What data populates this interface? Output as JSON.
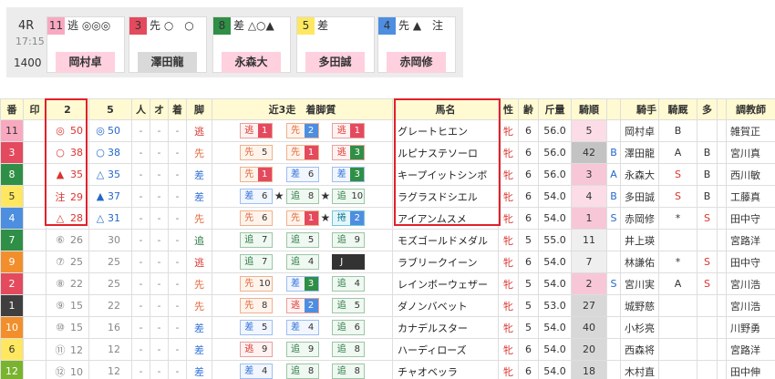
{
  "race": {
    "number": "4R",
    "time": "17:15",
    "distance": "1400"
  },
  "top_picks": [
    {
      "num": "11",
      "frame": 7,
      "marks": "逃 ◎◎◎",
      "jockey": "岡村卓",
      "jock_style": "pink"
    },
    {
      "num": "3",
      "frame": 2,
      "marks": "先 ○　○",
      "jockey": "澤田龍",
      "jock_style": "gray"
    },
    {
      "num": "8",
      "frame": 5,
      "marks": "差 △○▲",
      "jockey": "永森大",
      "jock_style": "pink"
    },
    {
      "num": "5",
      "frame": 4,
      "marks": "差",
      "jockey": "多田誠",
      "jock_style": "pink"
    },
    {
      "num": "4",
      "frame": 3,
      "marks": "先 ▲　注",
      "jockey": "赤岡修",
      "jock_style": "pink"
    }
  ],
  "headers": {
    "ban": "番",
    "in": "印",
    "c2": "2",
    "c5": "5",
    "hito": "人",
    "o": "オ",
    "chaku": "着",
    "ashi": "脚",
    "past": "近3走　着脚質",
    "name": "馬名",
    "sex": "性",
    "age": "齢",
    "weight": "斤量",
    "odds_rank": "騎順",
    "jockey": "騎手",
    "jk": "騎厩",
    "ta": "多",
    "trainer": "調教師"
  },
  "rows": [
    {
      "ban": "11",
      "frame": 7,
      "m2": "◎",
      "v2": "50",
      "m5": "◎",
      "v5": "50",
      "hito": "-",
      "o": "-",
      "chaku": "-",
      "ashi": "逃",
      "ashi_cls": "nige",
      "p": [
        {
          "st": "逃",
          "po": "1",
          "cls": "nige",
          "pw": 1
        },
        {
          "st": "先",
          "po": "2",
          "cls": "sen",
          "pw": 2
        },
        {
          "st": "逃",
          "po": "1",
          "cls": "nige",
          "pw": 1
        }
      ],
      "name": "グレートヒエン",
      "sex": "牝",
      "age": "6",
      "weight": "56.0",
      "rank": "5",
      "rank_cls": "lpk",
      "mark": "",
      "jockey": "岡村卓",
      "jk": "B",
      "ta": "",
      "trainer": "雑賀正"
    },
    {
      "ban": "3",
      "frame": 2,
      "m2": "○",
      "v2": "38",
      "m5": "○",
      "v5": "38",
      "hito": "-",
      "o": "-",
      "chaku": "-",
      "ashi": "先",
      "ashi_cls": "sen",
      "p": [
        {
          "st": "先",
          "po": "5",
          "cls": "sen",
          "pw": 0,
          "out": true
        },
        {
          "st": "先",
          "po": "1",
          "cls": "sen",
          "pw": 1
        },
        {
          "st": "逃",
          "po": "3",
          "cls": "nige",
          "pw": 3
        }
      ],
      "name": "ルピナステソーロ",
      "sex": "牝",
      "age": "6",
      "weight": "56.0",
      "rank": "42",
      "rank_cls": "dg",
      "mark": "B",
      "jockey": "澤田龍",
      "jk": "A",
      "ta": "B",
      "trainer": "宮川真"
    },
    {
      "ban": "8",
      "frame": 5,
      "m2": "▲",
      "v2": "35",
      "m5": "△",
      "v5": "35",
      "hito": "-",
      "o": "-",
      "chaku": "-",
      "ashi": "差",
      "ashi_cls": "sa",
      "p": [
        {
          "st": "先",
          "po": "1",
          "cls": "sen",
          "pw": 1
        },
        {
          "st": "差",
          "po": "6",
          "cls": "sa",
          "pw": 0,
          "out": true
        },
        {
          "st": "差",
          "po": "3",
          "cls": "sa",
          "pw": 3
        }
      ],
      "name": "キープイットシンボ",
      "sex": "牝",
      "age": "6",
      "weight": "56.0",
      "rank": "3",
      "rank_cls": "pk",
      "mark": "A",
      "jockey": "永森大",
      "jk": "S",
      "ta": "B",
      "trainer": "西川敏"
    },
    {
      "ban": "5",
      "frame": 4,
      "m2": "注",
      "v2": "29",
      "m5": "▲",
      "v5": "37",
      "hito": "-",
      "o": "-",
      "chaku": "-",
      "ashi": "差",
      "ashi_cls": "sa",
      "p": [
        {
          "st": "差",
          "po": "6",
          "cls": "sa",
          "pw": 0,
          "out": true,
          "star": true
        },
        {
          "st": "追",
          "po": "8",
          "cls": "oi",
          "pw": 0,
          "out": true,
          "star": true
        },
        {
          "st": "追",
          "po": "10",
          "cls": "oi",
          "pw": 0,
          "out": true
        }
      ],
      "name": "ラグラスドシエル",
      "sex": "牝",
      "age": "6",
      "weight": "54.0",
      "rank": "4",
      "rank_cls": "lpk",
      "mark": "B",
      "jockey": "多田誠",
      "jk": "S",
      "ta": "B",
      "trainer": "工藤真"
    },
    {
      "ban": "4",
      "frame": 3,
      "m2": "△",
      "v2": "28",
      "m5": "△",
      "v5": "31",
      "hito": "-",
      "o": "-",
      "chaku": "-",
      "ashi": "先",
      "ashi_cls": "sen",
      "p": [
        {
          "st": "先",
          "po": "6",
          "cls": "sen",
          "pw": 0,
          "out": true
        },
        {
          "st": "先",
          "po": "1",
          "cls": "sen",
          "pw": 1,
          "star": true
        },
        {
          "st": "捲",
          "po": "2",
          "cls": "ma",
          "pw": 2
        }
      ],
      "name": "アイアンムスメ",
      "sex": "牝",
      "age": "6",
      "weight": "54.0",
      "rank": "1",
      "rank_cls": "pk",
      "mark": "S",
      "jockey": "赤岡修",
      "jk": "*",
      "ta": "S",
      "trainer": "田中守"
    },
    {
      "ban": "7",
      "frame": 5,
      "m2": "⑥",
      "v2": "26",
      "m5": "",
      "v5": "30",
      "hito": "-",
      "o": "-",
      "chaku": "-",
      "ashi": "追",
      "ashi_cls": "oi",
      "p": [
        {
          "st": "追",
          "po": "7",
          "cls": "oi",
          "pw": 0,
          "out": true
        },
        {
          "st": "追",
          "po": "5",
          "cls": "oi",
          "pw": 0,
          "out": true
        },
        {
          "st": "追",
          "po": "9",
          "cls": "oi",
          "pw": 0,
          "out": true
        }
      ],
      "name": "モズゴールドメダル",
      "sex": "牝",
      "age": "5",
      "weight": "55.0",
      "rank": "11",
      "rank_cls": "",
      "mark": "",
      "jockey": "井上瑛",
      "jk": "",
      "ta": "",
      "trainer": "宮路洋"
    },
    {
      "ban": "9",
      "frame": 6,
      "m2": "⑦",
      "v2": "25",
      "m5": "",
      "v5": "25",
      "hito": "-",
      "o": "-",
      "chaku": "-",
      "ashi": "逃",
      "ashi_cls": "nige",
      "p": [
        {
          "st": "追",
          "po": "7",
          "cls": "oi",
          "pw": 0,
          "out": true
        },
        {
          "st": "追",
          "po": "4",
          "cls": "oi",
          "pw": 0,
          "out": true
        },
        {
          "st": "J",
          "po": "14",
          "cls": "j",
          "pw": 0,
          "out": true,
          "jb": true
        }
      ],
      "name": "ラブリークイーン",
      "sex": "牝",
      "age": "6",
      "weight": "54.0",
      "rank": "7",
      "rank_cls": "",
      "mark": "",
      "jockey": "林謙佑",
      "jk": "*",
      "ta": "S",
      "trainer": "田中守"
    },
    {
      "ban": "2",
      "frame": 2,
      "m2": "⑧",
      "v2": "22",
      "m5": "",
      "v5": "25",
      "hito": "-",
      "o": "-",
      "chaku": "-",
      "ashi": "先",
      "ashi_cls": "sen",
      "p": [
        {
          "st": "先",
          "po": "10",
          "cls": "sen",
          "pw": 0,
          "out": true
        },
        {
          "st": "差",
          "po": "3",
          "cls": "sa",
          "pw": 3
        },
        {
          "st": "追",
          "po": "4",
          "cls": "oi",
          "pw": 0,
          "out": true
        }
      ],
      "name": "レインボーウェザー",
      "sex": "牝",
      "age": "5",
      "weight": "54.0",
      "rank": "2",
      "rank_cls": "pk",
      "mark": "S",
      "jockey": "宮川実",
      "jk": "A",
      "ta": "S",
      "trainer": "宮川浩"
    },
    {
      "ban": "1",
      "frame": 1,
      "m2": "⑨",
      "v2": "15",
      "m5": "",
      "v5": "22",
      "hito": "-",
      "o": "-",
      "chaku": "-",
      "ashi": "先",
      "ashi_cls": "sen",
      "p": [
        {
          "st": "先",
          "po": "8",
          "cls": "sen",
          "pw": 0,
          "out": true
        },
        {
          "st": "逃",
          "po": "2",
          "cls": "nige",
          "pw": 2
        },
        {
          "st": "追",
          "po": "5",
          "cls": "oi",
          "pw": 0,
          "out": true
        }
      ],
      "name": "ダノンバベット",
      "sex": "牝",
      "age": "5",
      "weight": "53.0",
      "rank": "27",
      "rank_cls": "g",
      "mark": "",
      "jockey": "城野慈",
      "jk": "",
      "ta": "",
      "trainer": "宮川浩"
    },
    {
      "ban": "10",
      "frame": 6,
      "m2": "⑩",
      "v2": "15",
      "m5": "",
      "v5": "16",
      "hito": "-",
      "o": "-",
      "chaku": "-",
      "ashi": "差",
      "ashi_cls": "sa",
      "p": [
        {
          "st": "差",
          "po": "5",
          "cls": "sa",
          "pw": 0,
          "out": true
        },
        {
          "st": "差",
          "po": "4",
          "cls": "sa",
          "pw": 0,
          "out": true
        },
        {
          "st": "追",
          "po": "6",
          "cls": "oi",
          "pw": 0,
          "out": true
        }
      ],
      "name": "カナデルスター",
      "sex": "牝",
      "age": "5",
      "weight": "54.0",
      "rank": "40",
      "rank_cls": "g",
      "mark": "",
      "jockey": "小杉亮",
      "jk": "",
      "ta": "",
      "trainer": "川野勇"
    },
    {
      "ban": "6",
      "frame": 4,
      "m2": "⑪",
      "v2": "12",
      "m5": "",
      "v5": "12",
      "hito": "-",
      "o": "-",
      "chaku": "-",
      "ashi": "差",
      "ashi_cls": "sa",
      "p": [
        {
          "st": "逃",
          "po": "9",
          "cls": "nige",
          "pw": 0,
          "out": true
        },
        {
          "st": "追",
          "po": "9",
          "cls": "oi",
          "pw": 0,
          "out": true
        },
        {
          "st": "追",
          "po": "8",
          "cls": "oi",
          "pw": 0,
          "out": true
        }
      ],
      "name": "ハーディローズ",
      "sex": "牝",
      "age": "6",
      "weight": "54.0",
      "rank": "20",
      "rank_cls": "g",
      "mark": "",
      "jockey": "西森将",
      "jk": "",
      "ta": "",
      "trainer": "宮路洋"
    },
    {
      "ban": "12",
      "frame": 8,
      "m2": "⑫",
      "v2": "10",
      "m5": "",
      "v5": "12",
      "hito": "-",
      "o": "-",
      "chaku": "-",
      "ashi": "差",
      "ashi_cls": "sa",
      "p": [
        {
          "st": "差",
          "po": "4",
          "cls": "sa",
          "pw": 0,
          "out": true
        },
        {
          "st": "追",
          "po": "8",
          "cls": "oi",
          "pw": 0,
          "out": true
        },
        {
          "st": "追",
          "po": "8",
          "cls": "oi",
          "pw": 0,
          "out": true
        }
      ],
      "name": "チャオベッラ",
      "sex": "牝",
      "age": "6",
      "weight": "54.0",
      "rank": "18",
      "rank_cls": "g",
      "mark": "",
      "jockey": "木村直",
      "jk": "",
      "ta": "",
      "trainer": "田中伸"
    }
  ]
}
